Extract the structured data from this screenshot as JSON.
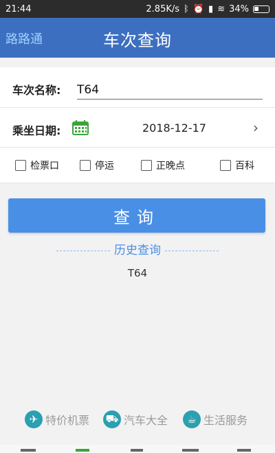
{
  "status_bar": {
    "time": "21:44",
    "speed": "2.85K/s",
    "battery": "34%",
    "icons": [
      "bluetooth-icon",
      "alarm-icon",
      "signal-icon",
      "wifi-icon"
    ]
  },
  "app_bar": {
    "left_label": "路路通",
    "title": "车次查询",
    "color": "#3d6fc0"
  },
  "form": {
    "train_label": "车次名称:",
    "train_value": "T64",
    "date_label": "乘坐日期:",
    "date_value": "2018-12-17",
    "checkboxes": [
      {
        "label": "检票口",
        "checked": false
      },
      {
        "label": "停运",
        "checked": false
      },
      {
        "label": "正晚点",
        "checked": false
      },
      {
        "label": "百科",
        "checked": false
      }
    ]
  },
  "query_button": {
    "label": "查询",
    "color": "#4a8fe6"
  },
  "history": {
    "title": "历史查询",
    "items": [
      "T64"
    ]
  },
  "services": [
    {
      "label": "特价机票",
      "icon": "airplane-icon"
    },
    {
      "label": "汽车大全",
      "icon": "car-icon"
    },
    {
      "label": "生活服务",
      "icon": "coffee-icon"
    }
  ]
}
